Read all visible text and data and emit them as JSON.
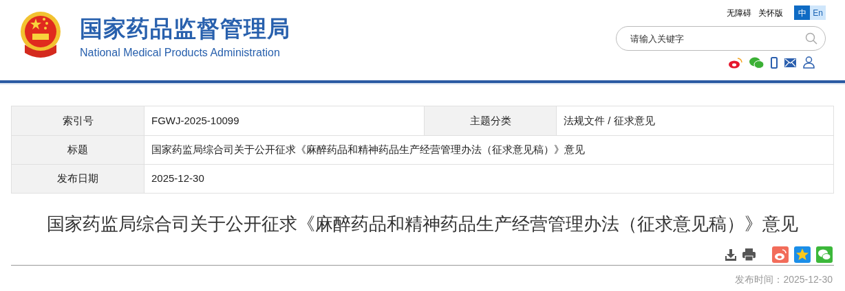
{
  "header": {
    "title": "国家药品监督管理局",
    "subtitle": "National Medical Products Administration",
    "links": [
      "无障碍",
      "关怀版"
    ],
    "languages": [
      {
        "label": "中",
        "selected": true
      },
      {
        "label": "En",
        "selected": false
      }
    ],
    "search": {
      "placeholder": "请输入关键字"
    }
  },
  "info_table": {
    "rows": [
      {
        "cells": [
          {
            "label": "索引号",
            "value": "FGWJ-2025-10099"
          },
          {
            "label": "主题分类",
            "value": "法规文件 / 征求意见"
          }
        ]
      },
      {
        "cells": [
          {
            "label": "标题",
            "value": "国家药监局综合司关于公开征求《麻醉药品和精神药品生产经营管理办法（征求意见稿）》意见"
          }
        ]
      },
      {
        "cells": [
          {
            "label": "发布日期",
            "value": "2025-12-30"
          }
        ]
      }
    ]
  },
  "article": {
    "title": "国家药监局综合司关于公开征求《麻醉药品和精神药品生产经营管理办法（征求意见稿）》意见",
    "publish_time": "发布时间：2025-12-30"
  }
}
